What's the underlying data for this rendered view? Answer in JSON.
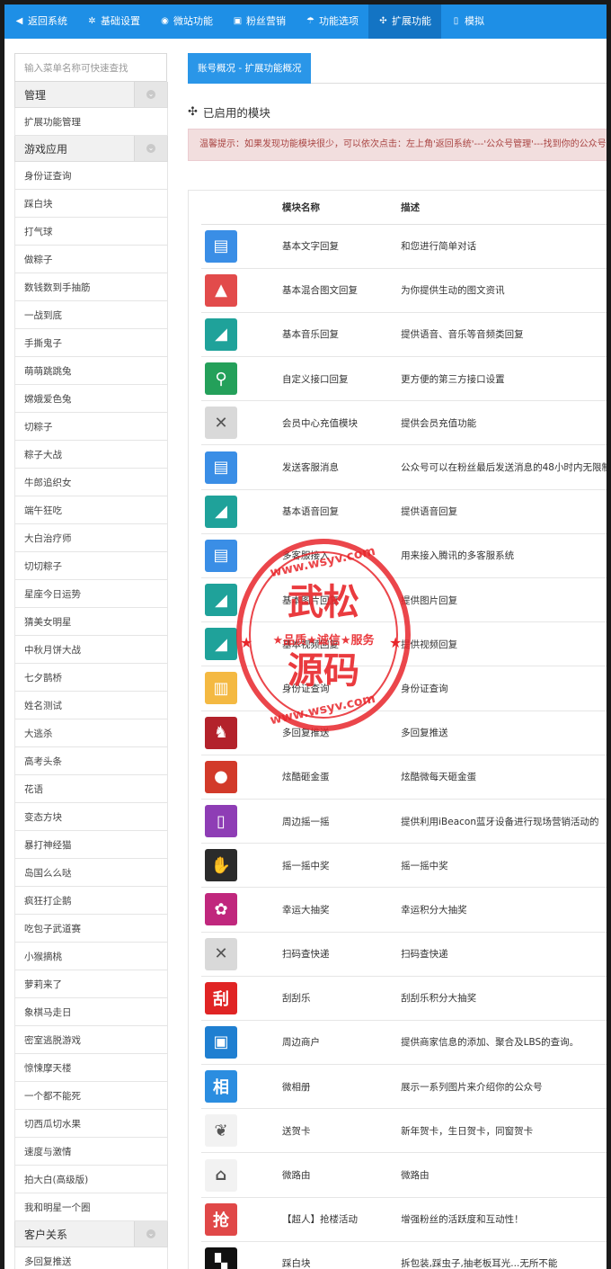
{
  "nav": [
    {
      "label": "返回系统",
      "icon": "back-icon",
      "glyph": "◀",
      "active": false
    },
    {
      "label": "基础设置",
      "icon": "gear-icon",
      "glyph": "✲",
      "active": false
    },
    {
      "label": "微站功能",
      "icon": "globe-icon",
      "glyph": "◉",
      "active": false
    },
    {
      "label": "粉丝营销",
      "icon": "gift-icon",
      "glyph": "▣",
      "active": false
    },
    {
      "label": "功能选项",
      "icon": "umbrella-icon",
      "glyph": "☂",
      "active": false
    },
    {
      "label": "扩展功能",
      "icon": "cubes-icon",
      "glyph": "✣",
      "active": true
    },
    {
      "label": "模拟",
      "icon": "phone-icon",
      "glyph": "▯",
      "active": false
    }
  ],
  "sidebar": {
    "search_placeholder": "输入菜单名称可快速查找",
    "groups": [
      {
        "title": "管理",
        "items": [
          "扩展功能管理"
        ]
      },
      {
        "title": "游戏应用",
        "items": [
          "身份证查询",
          "踩白块",
          "打气球",
          "做粽子",
          "数钱数到手抽筋",
          "一战到底",
          "手撕鬼子",
          "萌萌跳跳兔",
          "嫦娥爱色兔",
          "切粽子",
          "粽子大战",
          "牛郎追织女",
          "端午狂吃",
          "大白治疗师",
          "切切粽子",
          "星座今日运势",
          "猜美女明星",
          "中秋月饼大战",
          "七夕鹊桥",
          "姓名测试",
          "大逃杀",
          "高考头条",
          "花语",
          "变态方块",
          "暴打神经猫",
          "岛国么么哒",
          "疯狂打企鹅",
          "吃包子武道赛",
          "小猴摘桃",
          "萝莉来了",
          "象棋马走日",
          "密室逃脱游戏",
          "惊悚摩天楼",
          "一个都不能死",
          "切西瓜切水果",
          "速度与激情",
          "拍大白(高级版)",
          "我和明星一个圈"
        ]
      },
      {
        "title": "客户关系",
        "items": [
          "多回复推送"
        ]
      }
    ]
  },
  "main": {
    "tab": "账号概况 - 扩展功能概况",
    "section_title": "已启用的模块",
    "alert": "温馨提示：如果发现功能模块很少，可以依次点击：左上角'返回系统'---'公众号管理'---找到你的公众号",
    "columns": {
      "name": "模块名称",
      "desc": "描述"
    },
    "modules": [
      {
        "name": "基本文字回复",
        "desc": "和您进行简单对话",
        "icon": "book-icon",
        "glyph": "▤",
        "color": "#3a8ee6"
      },
      {
        "name": "基本混合图文回复",
        "desc": "为你提供生动的图文资讯",
        "icon": "picture-icon",
        "glyph": "▲",
        "color": "#e24b4b"
      },
      {
        "name": "基本音乐回复",
        "desc": "提供语音、音乐等音频类回复",
        "icon": "audio-icon",
        "glyph": "◢",
        "color": "#1fa29a"
      },
      {
        "name": "自定义接口回复",
        "desc": "更方便的第三方接口设置",
        "icon": "network-icon",
        "glyph": "⚲",
        "color": "#24a05a"
      },
      {
        "name": "会员中心充值模块",
        "desc": "提供会员充值功能",
        "icon": "x-icon",
        "glyph": "✕",
        "color": "#d9d9d9"
      },
      {
        "name": "发送客服消息",
        "desc": "公众号可以在粉丝最后发送消息的48小时内无限制",
        "icon": "book-icon",
        "glyph": "▤",
        "color": "#3a8ee6"
      },
      {
        "name": "基本语音回复",
        "desc": "提供语音回复",
        "icon": "audio-icon",
        "glyph": "◢",
        "color": "#1fa29a"
      },
      {
        "name": "多客服接入",
        "desc": "用来接入腾讯的多客服系统",
        "icon": "book-icon",
        "glyph": "▤",
        "color": "#3a8ee6"
      },
      {
        "name": "基本图片回复",
        "desc": "提供图片回复",
        "icon": "audio-icon",
        "glyph": "◢",
        "color": "#1fa29a"
      },
      {
        "name": "基本视频回复",
        "desc": "提供视频回复",
        "icon": "audio-icon",
        "glyph": "◢",
        "color": "#1fa29a"
      },
      {
        "name": "身份证查询",
        "desc": "身份证查询",
        "icon": "chart-icon",
        "glyph": "▥",
        "color": "#f4b942"
      },
      {
        "name": "多回复推送",
        "desc": "多回复推送",
        "icon": "bunny-icon",
        "glyph": "♞",
        "color": "#b3222b"
      },
      {
        "name": "炫酷砸金蛋",
        "desc": "炫酷微每天砸金蛋",
        "icon": "egg-icon",
        "glyph": "●",
        "color": "#d23a2a"
      },
      {
        "name": "周边摇一摇",
        "desc": "提供利用iBeacon蓝牙设备进行现场营销活动的",
        "icon": "shake-phone-icon",
        "glyph": "▯",
        "color": "#8e3db5"
      },
      {
        "name": "摇一摇中奖",
        "desc": "摇一摇中奖",
        "icon": "shake-icon",
        "glyph": "✋",
        "color": "#2b2b2b"
      },
      {
        "name": "幸运大抽奖",
        "desc": "幸运积分大抽奖",
        "icon": "lottery-icon",
        "glyph": "✿",
        "color": "#c0277d"
      },
      {
        "name": "扫码查快递",
        "desc": "扫码查快递",
        "icon": "x-icon",
        "glyph": "✕",
        "color": "#d9d9d9"
      },
      {
        "name": "刮刮乐",
        "desc": "刮刮乐积分大抽奖",
        "icon": "scratch-icon",
        "glyph": "刮",
        "color": "#e02424"
      },
      {
        "name": "周边商户",
        "desc": "提供商家信息的添加、聚合及LBS的查询。",
        "icon": "briefcase-icon",
        "glyph": "▣",
        "color": "#1f7fd1"
      },
      {
        "name": "微相册",
        "desc": "展示一系列图片来介绍你的公众号",
        "icon": "album-icon",
        "glyph": "相",
        "color": "#2b8de0"
      },
      {
        "name": "送贺卡",
        "desc": "新年贺卡，生日贺卡，同窗贺卡",
        "icon": "ribbon-icon",
        "glyph": "❦",
        "color": "#f2f2f2"
      },
      {
        "name": "微路由",
        "desc": "微路由",
        "icon": "router-icon",
        "glyph": "⌂",
        "color": "#f2f2f2"
      },
      {
        "name": "【超人】抢楼活动",
        "desc": "增强粉丝的活跃度和互动性！",
        "icon": "grab-icon",
        "glyph": "抢",
        "color": "#e04848"
      },
      {
        "name": "踩白块",
        "desc": "拆包装,踩虫子,抽老板耳光...无所不能",
        "icon": "tiles-icon",
        "glyph": "▚",
        "color": "#111111"
      }
    ]
  },
  "watermark": {
    "line1": "武松",
    "line2": "源码",
    "band": "★品质★诚信★服务",
    "url": "www.wsyv.com"
  }
}
